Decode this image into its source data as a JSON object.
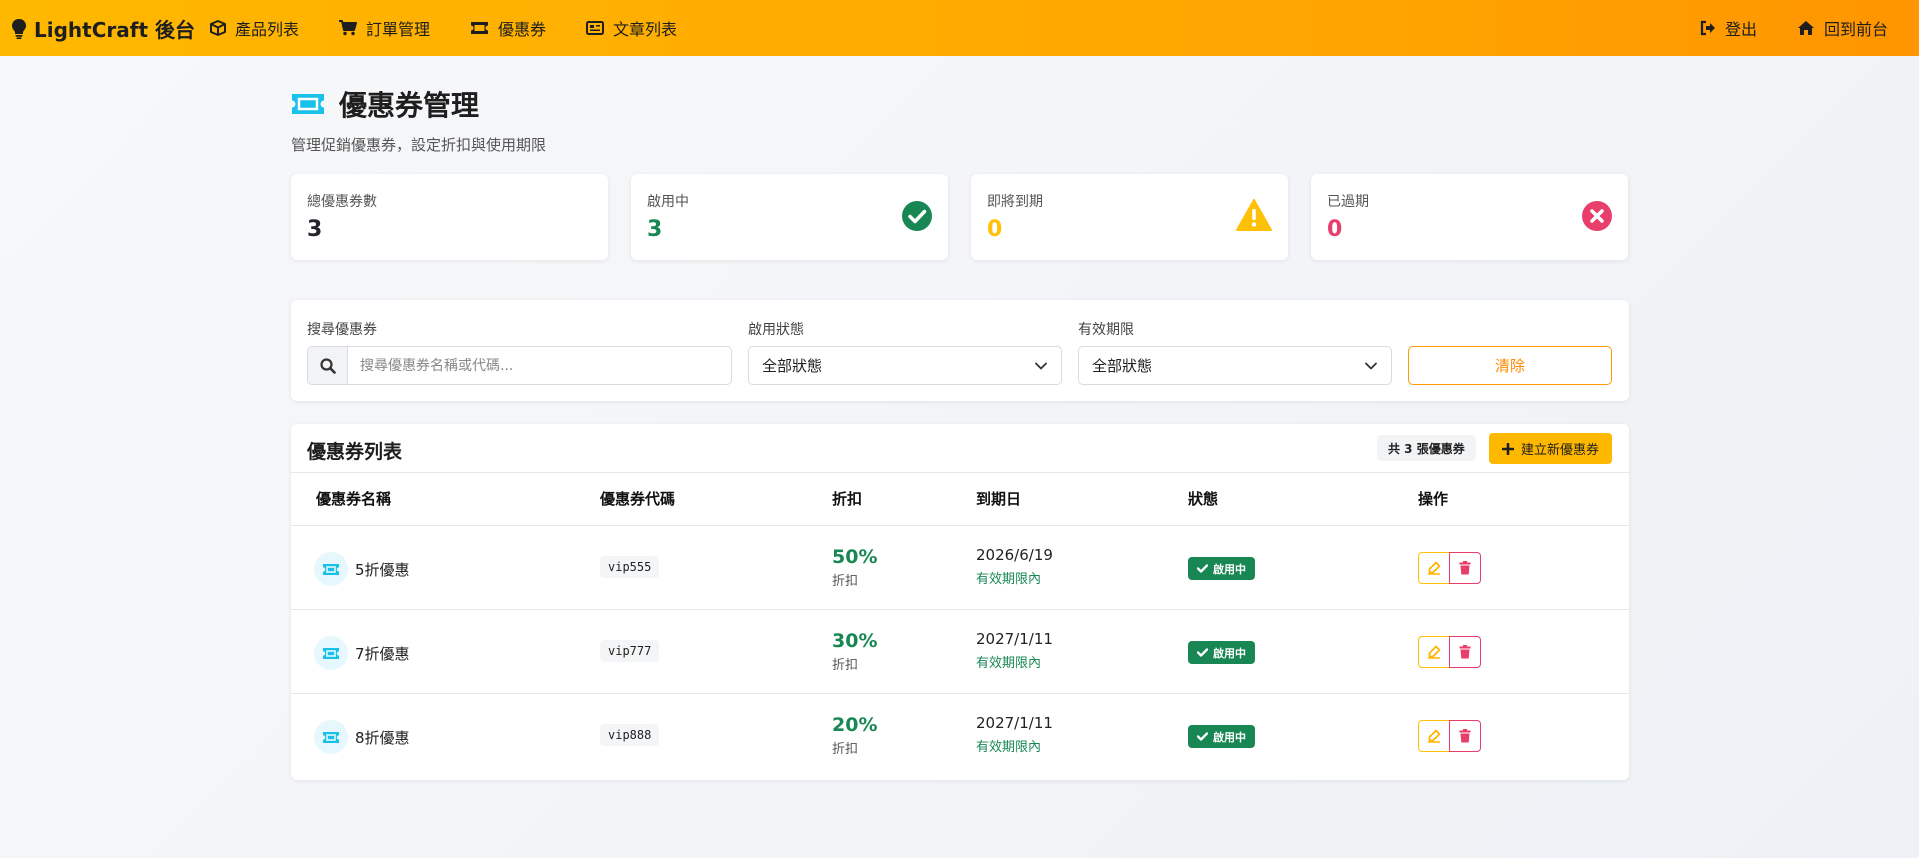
{
  "nav": {
    "brand": "LightCraft 後台",
    "links": [
      {
        "label": "產品列表",
        "icon": "box-icon"
      },
      {
        "label": "訂單管理",
        "icon": "cart-icon"
      },
      {
        "label": "優惠券",
        "icon": "ticket-icon"
      },
      {
        "label": "文章列表",
        "icon": "newspaper-icon"
      }
    ],
    "right": [
      {
        "label": "登出",
        "icon": "logout-icon"
      },
      {
        "label": "回到前台",
        "icon": "home-icon"
      }
    ]
  },
  "header": {
    "title": "優惠券管理",
    "subtitle": "管理促銷優惠券，設定折扣與使用期限"
  },
  "stats": [
    {
      "label": "總優惠券數",
      "value": "3",
      "color": "#212529"
    },
    {
      "label": "啟用中",
      "value": "3",
      "color": "#198754",
      "icon": "check-circle-icon"
    },
    {
      "label": "即將到期",
      "value": "0",
      "color": "#ffc107",
      "icon": "warning-icon"
    },
    {
      "label": "已過期",
      "value": "0",
      "color": "#e83e6c",
      "icon": "x-circle-icon"
    }
  ],
  "filters": {
    "search_label": "搜尋優惠券",
    "search_placeholder": "搜尋優惠券名稱或代碼...",
    "status_label": "啟用狀態",
    "status_value": "全部狀態",
    "expiry_label": "有效期限",
    "expiry_value": "全部狀態",
    "clear_label": "清除"
  },
  "list": {
    "title": "優惠券列表",
    "count_badge": "共 3 張優惠券",
    "new_button": "建立新優惠券",
    "columns": [
      "優惠券名稱",
      "優惠券代碼",
      "折扣",
      "到期日",
      "狀態",
      "操作"
    ],
    "rows": [
      {
        "name": "5折優惠",
        "code": "vip555",
        "discount": "50%",
        "discount_label": "折扣",
        "expiry": "2026/6/19",
        "validity": "有效期限內",
        "status": "啟用中"
      },
      {
        "name": "7折優惠",
        "code": "vip777",
        "discount": "30%",
        "discount_label": "折扣",
        "expiry": "2027/1/11",
        "validity": "有效期限內",
        "status": "啟用中"
      },
      {
        "name": "8折優惠",
        "code": "vip888",
        "discount": "20%",
        "discount_label": "折扣",
        "expiry": "2027/1/11",
        "validity": "有效期限內",
        "status": "啟用中"
      }
    ]
  },
  "colors": {
    "accent": "#ffb800",
    "success": "#198754",
    "warning": "#ffc107",
    "danger": "#e83e6c",
    "ticket": "#17c1e8"
  }
}
